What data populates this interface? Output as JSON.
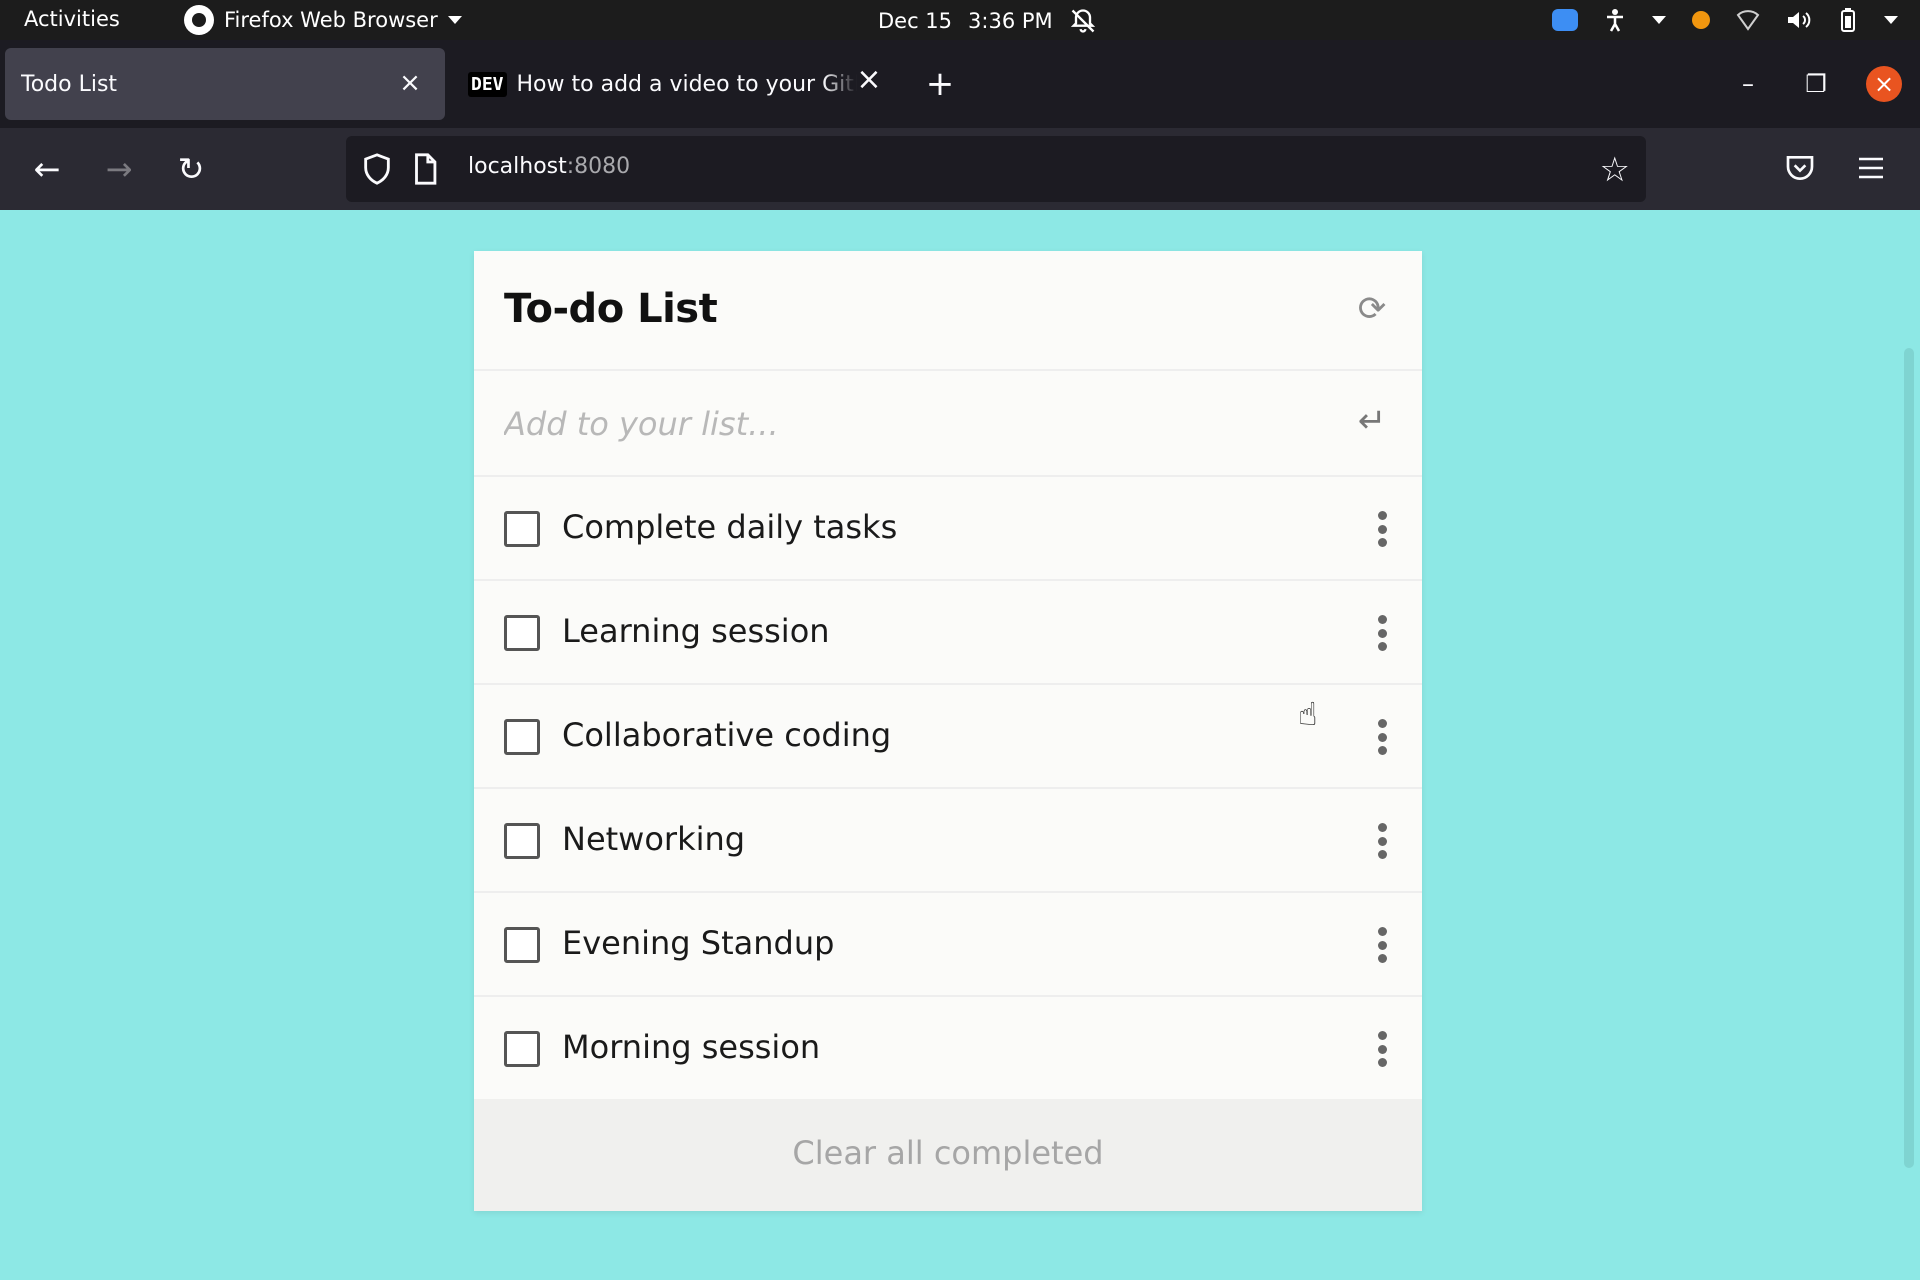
{
  "system_bar": {
    "activities": "Activities",
    "app_name": "Firefox Web Browser",
    "date": "Dec 15",
    "time": "3:36 PM",
    "tray_icons": [
      "zoom-icon",
      "accessibility-icon",
      "orange-indicator-icon",
      "network-icon",
      "volume-icon",
      "battery-icon"
    ]
  },
  "browser": {
    "tabs": [
      {
        "title": "Todo List",
        "active": true
      },
      {
        "favicon": "DEV",
        "title": "How to add a video to your GitHub",
        "active": false
      }
    ],
    "url_host": "localhost",
    "url_port": ":8080"
  },
  "todo": {
    "title": "To-do List",
    "input_placeholder": "Add to your list...",
    "items": [
      {
        "label": "Complete daily tasks",
        "checked": false
      },
      {
        "label": "Learning session",
        "checked": false
      },
      {
        "label": "Collaborative coding",
        "checked": false
      },
      {
        "label": "Networking",
        "checked": false
      },
      {
        "label": "Evening Standup",
        "checked": false
      },
      {
        "label": "Morning session",
        "checked": false
      }
    ],
    "clear_label": "Clear all completed"
  },
  "colors": {
    "page_background": "#8de8e5",
    "card_background": "#fbfbf9",
    "accent_close": "#e95420"
  }
}
